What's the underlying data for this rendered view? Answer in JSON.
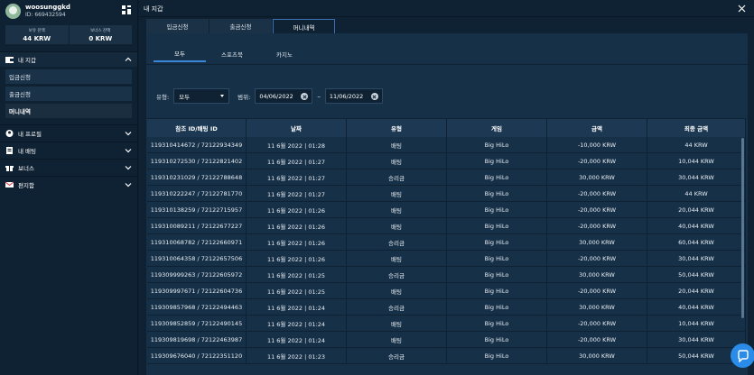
{
  "user": {
    "name": "woosunggkd",
    "id": "ID: 669432594"
  },
  "balances": [
    {
      "label": "보유 잔액",
      "value": "44 KRW"
    },
    {
      "label": "보너스 잔액",
      "value": "0 KRW"
    }
  ],
  "sidebar": {
    "wallet": {
      "label": "내 지갑",
      "items": [
        "입금신청",
        "출금신청",
        "머니내역"
      ]
    },
    "profile": "내 프로필",
    "betting": "내 배팅",
    "bonus": "보너스",
    "mail": "편지함"
  },
  "main": {
    "title": "내 지갑",
    "tabs": [
      "입금신청",
      "출금신청",
      "머니내역"
    ],
    "subtabs": [
      "모두",
      "스포츠북",
      "카지노"
    ],
    "filters": {
      "type_label": "유형:",
      "type_value": "모두",
      "range_label": "범위:",
      "date_from": "04/06/2022",
      "date_to": "11/06/2022",
      "dash": "–"
    },
    "columns": [
      "참조 ID/배팅 ID",
      "날짜",
      "유형",
      "게임",
      "금액",
      "최종 금액"
    ]
  },
  "rows": [
    [
      "119310414672 / 72122934349",
      "11 6월 2022 | 01:28",
      "배팅",
      "Big HiLo",
      "-10,000 KRW",
      "44 KRW"
    ],
    [
      "119310272530 / 72122821402",
      "11 6월 2022 | 01:27",
      "배팅",
      "Big HiLo",
      "-20,000 KRW",
      "10,044 KRW"
    ],
    [
      "119310231029 / 72122788648",
      "11 6월 2022 | 01:27",
      "승리금",
      "Big HiLo",
      "30,000 KRW",
      "30,044 KRW"
    ],
    [
      "119310222247 / 72122781770",
      "11 6월 2022 | 01:27",
      "배팅",
      "Big HiLo",
      "-20,000 KRW",
      "44 KRW"
    ],
    [
      "119310138259 / 72122715957",
      "11 6월 2022 | 01:26",
      "배팅",
      "Big HiLo",
      "-20,000 KRW",
      "20,044 KRW"
    ],
    [
      "119310089211 / 72122677227",
      "11 6월 2022 | 01:26",
      "배팅",
      "Big HiLo",
      "-20,000 KRW",
      "40,044 KRW"
    ],
    [
      "119310068782 / 72122660971",
      "11 6월 2022 | 01:26",
      "승리금",
      "Big HiLo",
      "30,000 KRW",
      "60,044 KRW"
    ],
    [
      "119310064358 / 72122657506",
      "11 6월 2022 | 01:26",
      "배팅",
      "Big HiLo",
      "-20,000 KRW",
      "30,044 KRW"
    ],
    [
      "119309999263 / 72122605972",
      "11 6월 2022 | 01:25",
      "승리금",
      "Big HiLo",
      "30,000 KRW",
      "50,044 KRW"
    ],
    [
      "119309997671 / 72122604736",
      "11 6월 2022 | 01:25",
      "배팅",
      "Big HiLo",
      "-20,000 KRW",
      "20,044 KRW"
    ],
    [
      "119309857968 / 72122494463",
      "11 6월 2022 | 01:24",
      "승리금",
      "Big HiLo",
      "30,000 KRW",
      "40,044 KRW"
    ],
    [
      "119309852859 / 72122490145",
      "11 6월 2022 | 01:24",
      "배팅",
      "Big HiLo",
      "-20,000 KRW",
      "10,044 KRW"
    ],
    [
      "119309819698 / 72122463987",
      "11 6월 2022 | 01:24",
      "배팅",
      "Big HiLo",
      "-20,000 KRW",
      "30,044 KRW"
    ],
    [
      "119309676040 / 72122351120",
      "11 6월 2022 | 01:23",
      "승리금",
      "Big HiLo",
      "30,000 KRW",
      "50,044 KRW"
    ]
  ]
}
